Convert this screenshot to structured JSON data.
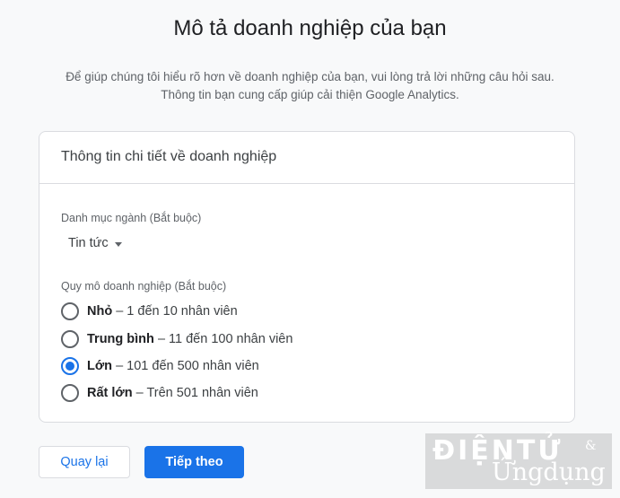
{
  "page": {
    "title": "Mô tả doanh nghiệp của bạn",
    "description_line1": "Để giúp chúng tôi hiểu rõ hơn về doanh nghiệp của bạn, vui lòng trả lời những câu hỏi sau.",
    "description_line2": "Thông tin bạn cung cấp giúp cải thiện Google Analytics."
  },
  "card": {
    "header": "Thông tin chi tiết về doanh nghiệp",
    "industry": {
      "label": "Danh mục ngành (Bắt buộc)",
      "selected_value": "Tin tức"
    },
    "size": {
      "label": "Quy mô doanh nghiệp (Bắt buộc)",
      "options": [
        {
          "name": "Nhỏ",
          "detail": "– 1 đến 10 nhân viên",
          "checked": false
        },
        {
          "name": "Trung bình",
          "detail": "– 11 đến 100 nhân viên",
          "checked": false
        },
        {
          "name": "Lớn",
          "detail": "– 101 đến 500 nhân viên",
          "checked": true
        },
        {
          "name": "Rất lớn",
          "detail": "– Trên 501 nhân viên",
          "checked": false
        }
      ]
    }
  },
  "buttons": {
    "back_label": "Quay lại",
    "next_label": "Tiếp theo"
  },
  "watermark": {
    "line1": "ĐIỆNTỬ",
    "amp": "&",
    "line2": "Ứngdụng"
  },
  "colors": {
    "accent": "#1a73e8",
    "background": "#f8f9fa"
  }
}
